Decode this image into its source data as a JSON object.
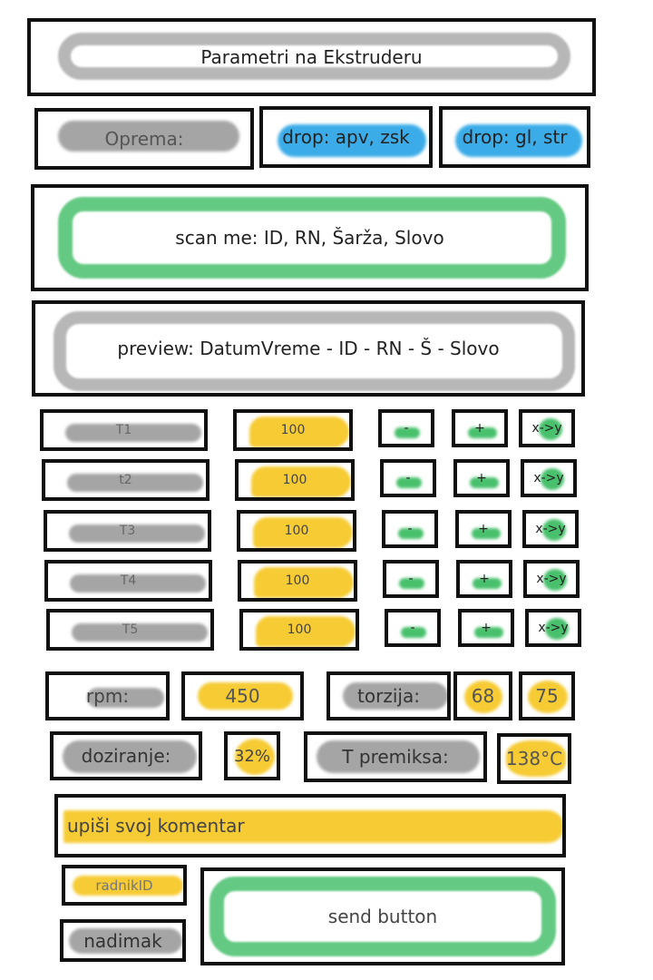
{
  "header": {
    "title": "Parametri na Ekstruderu"
  },
  "equipment": {
    "label": "Oprema:",
    "dropdown1": "drop: apv, zsk",
    "dropdown2": "drop: gl, str"
  },
  "scan": {
    "label": "scan me: ID, RN, Šarža, Slovo"
  },
  "preview": {
    "label": "preview: DatumVreme - ID - RN - Š - Slovo"
  },
  "temps": [
    {
      "label": "T1",
      "value": "100",
      "minus": "-",
      "plus": "+",
      "convert": "x->y"
    },
    {
      "label": "t2",
      "value": "100",
      "minus": "-",
      "plus": "+",
      "convert": "x->y"
    },
    {
      "label": "T3",
      "value": "100",
      "minus": "-",
      "plus": "+",
      "convert": "x->y"
    },
    {
      "label": "T4",
      "value": "100",
      "minus": "-",
      "plus": "+",
      "convert": "x->y"
    },
    {
      "label": "T5",
      "value": "100",
      "minus": "-",
      "plus": "+",
      "convert": "x->y"
    }
  ],
  "rpm": {
    "label": "rpm:",
    "value": "450"
  },
  "torque": {
    "label": "torzija:",
    "value1": "68",
    "value2": "75"
  },
  "dosing": {
    "label": "doziranje:",
    "value": "32%"
  },
  "premix": {
    "label": "T premiksa:",
    "value": "138°C"
  },
  "comment": {
    "placeholder": "upiši svoj komentar"
  },
  "worker": {
    "id_label": "radnikID",
    "nickname": "nadimak"
  },
  "send": {
    "label": "send button"
  }
}
